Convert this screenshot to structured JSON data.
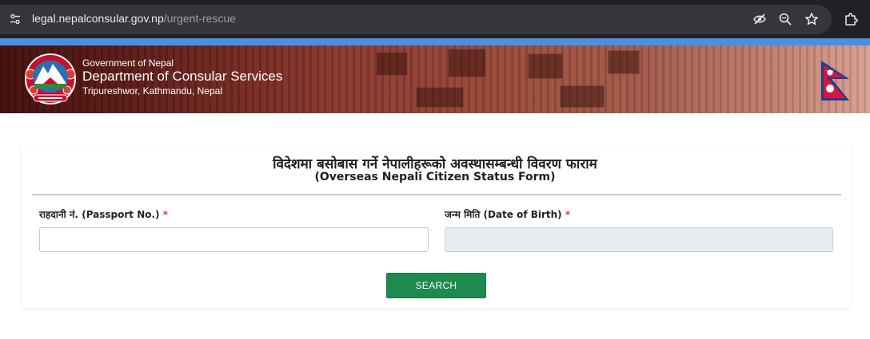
{
  "browser": {
    "url_host": "legal.nepalconsular.gov.np",
    "url_path": "/urgent-rescue",
    "icons": [
      "tune-icon",
      "eye-off-icon",
      "zoom-icon",
      "star-icon",
      "extensions-icon"
    ]
  },
  "header": {
    "gov_name": "Government of Nepal",
    "dept_name": "Department of Consular Services",
    "address": "Tripureshwor, Kathmandu, Nepal",
    "emblem": "nepal-emblem-icon",
    "flag": "nepal-flag-icon"
  },
  "form": {
    "title_np": "विदेशमा बसोबास गर्ने नेपालीहरूको अवस्थासम्बन्धी विवरण फाराम",
    "title_en": "(Overseas Nepali Citizen Status Form)",
    "passport": {
      "label": "राहदानी नं. (Passport No.)",
      "required_mark": "*",
      "value": ""
    },
    "dob": {
      "label": "जन्म मिति (Date of Birth)",
      "required_mark": "*",
      "value": "",
      "disabled": true
    },
    "search_label": "SEARCH"
  },
  "colors": {
    "accent_bar": "#4a90e2",
    "button": "#1e8a4f",
    "required": "#e53935"
  }
}
